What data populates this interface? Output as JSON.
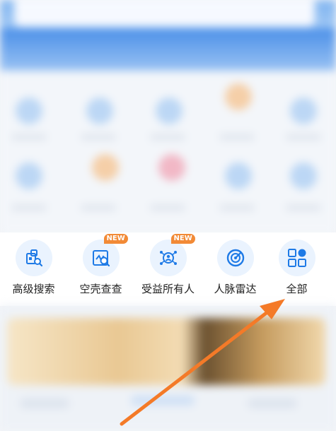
{
  "tools": [
    {
      "label": "高级搜索",
      "icon": "advanced-search-icon",
      "badge": ""
    },
    {
      "label": "空壳查查",
      "icon": "shell-check-icon",
      "badge": "NEW"
    },
    {
      "label": "受益所有人",
      "icon": "beneficial-owner-icon",
      "badge": "NEW"
    },
    {
      "label": "人脉雷达",
      "icon": "network-radar-icon",
      "badge": ""
    },
    {
      "label": "全部",
      "icon": "all-apps-icon",
      "badge": ""
    }
  ],
  "colors": {
    "icon_primary": "#1e7ae6",
    "icon_bg": "#eaf3fe",
    "badge": "#f28a36",
    "arrow": "#f47a28"
  }
}
